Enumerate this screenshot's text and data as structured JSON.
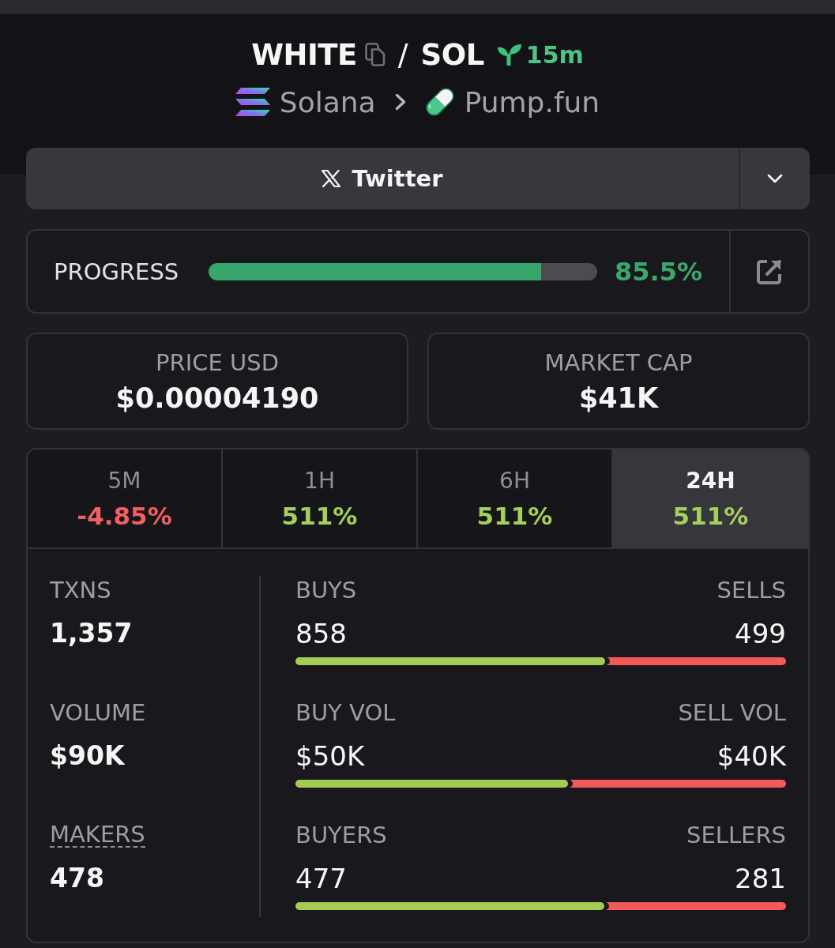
{
  "header": {
    "base_token": "WHITE",
    "separator": "/",
    "quote_token": "SOL",
    "age": "15m",
    "chain": "Solana",
    "dex": "Pump.fun"
  },
  "social_button": {
    "label": "Twitter"
  },
  "progress": {
    "label": "PROGRESS",
    "level": 0.855,
    "reading": "85.5%"
  },
  "price_cards": [
    {
      "label": "PRICE USD",
      "value": "$0.00004190"
    },
    {
      "label": "MARKET CAP",
      "value": "$41K"
    }
  ],
  "timeframe_tabs": [
    {
      "label": "5M",
      "change": "-4.85%",
      "negative": true,
      "selected": false
    },
    {
      "label": "1H",
      "change": "511%",
      "negative": false,
      "selected": false
    },
    {
      "label": "6H",
      "change": "511%",
      "negative": false,
      "selected": false
    },
    {
      "label": "24H",
      "change": "511%",
      "negative": false,
      "selected": true
    }
  ],
  "metrics": [
    {
      "label": "TXNS",
      "value": "1,357",
      "dashed_underline": false
    },
    {
      "label": "VOLUME",
      "value": "$90K",
      "dashed_underline": false
    },
    {
      "label": "MAKERS",
      "value": "478",
      "dashed_underline": true
    }
  ],
  "splits": [
    {
      "buy_label": "BUYS",
      "buy_value": "858",
      "sell_label": "SELLS",
      "sell_value": "499",
      "level": 0.632
    },
    {
      "buy_label": "BUY VOL",
      "buy_value": "$50K",
      "sell_label": "SELL VOL",
      "sell_value": "$40K",
      "level": 0.556
    },
    {
      "buy_label": "BUYERS",
      "buy_value": "477",
      "sell_label": "SELLERS",
      "sell_value": "281",
      "level": 0.629
    }
  ]
}
